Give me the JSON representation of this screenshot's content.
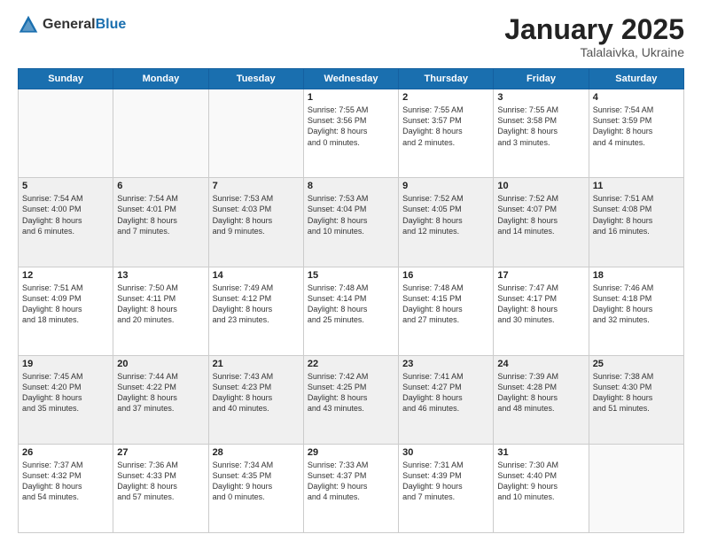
{
  "header": {
    "logo_general": "General",
    "logo_blue": "Blue",
    "month": "January 2025",
    "location": "Talalaivka, Ukraine"
  },
  "weekdays": [
    "Sunday",
    "Monday",
    "Tuesday",
    "Wednesday",
    "Thursday",
    "Friday",
    "Saturday"
  ],
  "weeks": [
    [
      {
        "day": "",
        "content": ""
      },
      {
        "day": "",
        "content": ""
      },
      {
        "day": "",
        "content": ""
      },
      {
        "day": "1",
        "content": "Sunrise: 7:55 AM\nSunset: 3:56 PM\nDaylight: 8 hours\nand 0 minutes."
      },
      {
        "day": "2",
        "content": "Sunrise: 7:55 AM\nSunset: 3:57 PM\nDaylight: 8 hours\nand 2 minutes."
      },
      {
        "day": "3",
        "content": "Sunrise: 7:55 AM\nSunset: 3:58 PM\nDaylight: 8 hours\nand 3 minutes."
      },
      {
        "day": "4",
        "content": "Sunrise: 7:54 AM\nSunset: 3:59 PM\nDaylight: 8 hours\nand 4 minutes."
      }
    ],
    [
      {
        "day": "5",
        "content": "Sunrise: 7:54 AM\nSunset: 4:00 PM\nDaylight: 8 hours\nand 6 minutes."
      },
      {
        "day": "6",
        "content": "Sunrise: 7:54 AM\nSunset: 4:01 PM\nDaylight: 8 hours\nand 7 minutes."
      },
      {
        "day": "7",
        "content": "Sunrise: 7:53 AM\nSunset: 4:03 PM\nDaylight: 8 hours\nand 9 minutes."
      },
      {
        "day": "8",
        "content": "Sunrise: 7:53 AM\nSunset: 4:04 PM\nDaylight: 8 hours\nand 10 minutes."
      },
      {
        "day": "9",
        "content": "Sunrise: 7:52 AM\nSunset: 4:05 PM\nDaylight: 8 hours\nand 12 minutes."
      },
      {
        "day": "10",
        "content": "Sunrise: 7:52 AM\nSunset: 4:07 PM\nDaylight: 8 hours\nand 14 minutes."
      },
      {
        "day": "11",
        "content": "Sunrise: 7:51 AM\nSunset: 4:08 PM\nDaylight: 8 hours\nand 16 minutes."
      }
    ],
    [
      {
        "day": "12",
        "content": "Sunrise: 7:51 AM\nSunset: 4:09 PM\nDaylight: 8 hours\nand 18 minutes."
      },
      {
        "day": "13",
        "content": "Sunrise: 7:50 AM\nSunset: 4:11 PM\nDaylight: 8 hours\nand 20 minutes."
      },
      {
        "day": "14",
        "content": "Sunrise: 7:49 AM\nSunset: 4:12 PM\nDaylight: 8 hours\nand 23 minutes."
      },
      {
        "day": "15",
        "content": "Sunrise: 7:48 AM\nSunset: 4:14 PM\nDaylight: 8 hours\nand 25 minutes."
      },
      {
        "day": "16",
        "content": "Sunrise: 7:48 AM\nSunset: 4:15 PM\nDaylight: 8 hours\nand 27 minutes."
      },
      {
        "day": "17",
        "content": "Sunrise: 7:47 AM\nSunset: 4:17 PM\nDaylight: 8 hours\nand 30 minutes."
      },
      {
        "day": "18",
        "content": "Sunrise: 7:46 AM\nSunset: 4:18 PM\nDaylight: 8 hours\nand 32 minutes."
      }
    ],
    [
      {
        "day": "19",
        "content": "Sunrise: 7:45 AM\nSunset: 4:20 PM\nDaylight: 8 hours\nand 35 minutes."
      },
      {
        "day": "20",
        "content": "Sunrise: 7:44 AM\nSunset: 4:22 PM\nDaylight: 8 hours\nand 37 minutes."
      },
      {
        "day": "21",
        "content": "Sunrise: 7:43 AM\nSunset: 4:23 PM\nDaylight: 8 hours\nand 40 minutes."
      },
      {
        "day": "22",
        "content": "Sunrise: 7:42 AM\nSunset: 4:25 PM\nDaylight: 8 hours\nand 43 minutes."
      },
      {
        "day": "23",
        "content": "Sunrise: 7:41 AM\nSunset: 4:27 PM\nDaylight: 8 hours\nand 46 minutes."
      },
      {
        "day": "24",
        "content": "Sunrise: 7:39 AM\nSunset: 4:28 PM\nDaylight: 8 hours\nand 48 minutes."
      },
      {
        "day": "25",
        "content": "Sunrise: 7:38 AM\nSunset: 4:30 PM\nDaylight: 8 hours\nand 51 minutes."
      }
    ],
    [
      {
        "day": "26",
        "content": "Sunrise: 7:37 AM\nSunset: 4:32 PM\nDaylight: 8 hours\nand 54 minutes."
      },
      {
        "day": "27",
        "content": "Sunrise: 7:36 AM\nSunset: 4:33 PM\nDaylight: 8 hours\nand 57 minutes."
      },
      {
        "day": "28",
        "content": "Sunrise: 7:34 AM\nSunset: 4:35 PM\nDaylight: 9 hours\nand 0 minutes."
      },
      {
        "day": "29",
        "content": "Sunrise: 7:33 AM\nSunset: 4:37 PM\nDaylight: 9 hours\nand 4 minutes."
      },
      {
        "day": "30",
        "content": "Sunrise: 7:31 AM\nSunset: 4:39 PM\nDaylight: 9 hours\nand 7 minutes."
      },
      {
        "day": "31",
        "content": "Sunrise: 7:30 AM\nSunset: 4:40 PM\nDaylight: 9 hours\nand 10 minutes."
      },
      {
        "day": "",
        "content": ""
      }
    ]
  ],
  "gray_rows": [
    1,
    3
  ]
}
